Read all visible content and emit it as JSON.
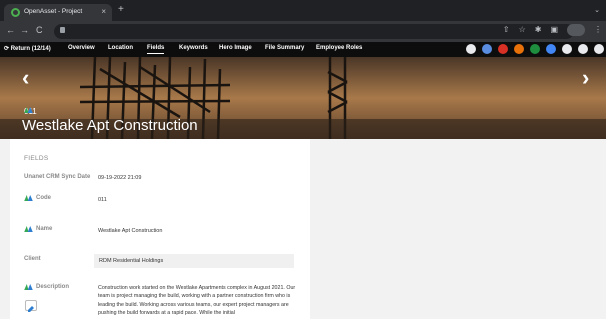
{
  "browser": {
    "tab_title": "OpenAsset - Project",
    "tab_close": "×",
    "new_tab": "+",
    "menu": "⌄",
    "back": "←",
    "forward": "→",
    "reload": "C"
  },
  "appnav": {
    "back_label": "Return (12/14)",
    "items": [
      "Overview",
      "Location",
      "Fields",
      "Keywords",
      "Hero Image",
      "File Summary",
      "Employee Roles"
    ],
    "active": "Fields"
  },
  "hero": {
    "prev_arrow": "‹",
    "next_arrow": "›",
    "project_code": "011",
    "project_title": "Westlake Apt Construction"
  },
  "fields": {
    "section_title": "FIELDS",
    "sync_label": "Unanet CRM Sync Date",
    "sync_value": "09-19-2022 21:09",
    "code_label": "Code",
    "code_value": "011",
    "name_label": "Name",
    "name_value": "Westlake Apt Construction",
    "client_label": "Client",
    "client_value": "RDM Residential Holdings",
    "description_label": "Description",
    "description_value": "Construction work started on the Westlake Apartments complex in August 2021. Our team is project managing the build, working with a partner construction firm who is leading the build. Working across various teams, our expert project managers are pushing the build forwards at a rapid pace. While the initial"
  },
  "colors": {
    "brand_green": "#34a853",
    "brand_blue": "#2f7fd1"
  }
}
